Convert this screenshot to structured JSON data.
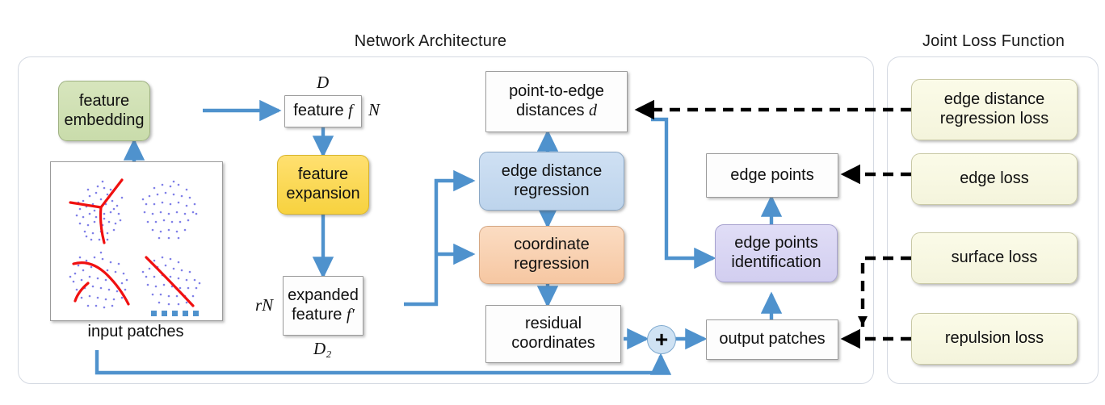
{
  "panels": {
    "network": {
      "title": "Network Architecture"
    },
    "loss": {
      "title": "Joint Loss Function"
    }
  },
  "nodes": {
    "feature_embedding": "feature\nembedding",
    "feature_expansion": "feature\nexpansion",
    "feature_f": "feature f",
    "expanded_feature": "expanded\nfeature f′",
    "edge_distance_regression": "edge distance\nregression",
    "coordinate_regression": "coordinate\nregression",
    "point_to_edge_distances": "point-to-edge\ndistances d",
    "residual_coordinates": "residual\ncoordinates",
    "edge_points": "edge points",
    "edge_points_identification": "edge points\nidentification",
    "output_patches": "output patches",
    "plus_symbol": "+"
  },
  "labels": {
    "D": "D",
    "N": "N",
    "rN": "rN",
    "D2": "D₂",
    "input_patches_caption": "input patches"
  },
  "losses": [
    {
      "id": "edge-distance-regression-loss",
      "label": "edge distance\nregression loss"
    },
    {
      "id": "edge-loss",
      "label": "edge loss"
    },
    {
      "id": "surface-loss",
      "label": "surface loss"
    },
    {
      "id": "repulsion-loss",
      "label": "repulsion loss"
    }
  ],
  "colors": {
    "arrow_blue": "#4f92cd",
    "arrow_black": "#000000",
    "green_box": "#cdddb0",
    "yellow_box": "#fbd43f",
    "blue_box": "#c3d7ee",
    "orange_box": "#f8cfad",
    "purple_box": "#d8d5f0",
    "cream_box": "#f7f7e2",
    "panel_border": "#d4d9e2",
    "point_cloud_points": "#7b7be0",
    "point_cloud_edges": "#f01010"
  },
  "input_patches_figure": {
    "type": "point-cloud-thumbnails",
    "patch_count": 4,
    "ellipsis_dots": 5
  }
}
